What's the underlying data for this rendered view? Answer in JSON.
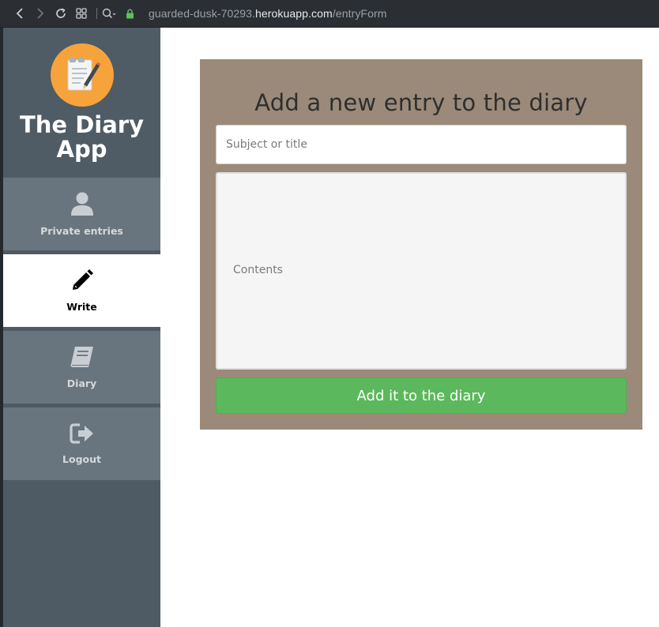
{
  "browser": {
    "url_host": "guarded-dusk-70293.",
    "url_domain": "herokuapp.com",
    "url_path": "/entryForm",
    "icons": [
      "back-icon",
      "forward-icon",
      "reload-icon",
      "tabs-grid-icon",
      "zoom-icon",
      "lock-icon"
    ]
  },
  "sidebar": {
    "app_title": "The Diary App",
    "logo_icon": "notepad-pen-icon",
    "items": [
      {
        "label": "Private entries",
        "icon": "user-icon",
        "active": false
      },
      {
        "label": "Write",
        "icon": "pencil-icon",
        "active": true
      },
      {
        "label": "Diary",
        "icon": "book-icon",
        "active": false
      },
      {
        "label": "Logout",
        "icon": "sign-out-icon",
        "active": false
      }
    ]
  },
  "form": {
    "title": "Add a new entry to the diary",
    "subject_placeholder": "Subject or title",
    "subject_value": "",
    "contents_placeholder": "Contents",
    "contents_value": "",
    "submit_label": "Add it to the diary"
  },
  "colors": {
    "sidebar_bg": "#4e5b64",
    "nav_item_bg": "#69757e",
    "card_bg": "#9b8a7a",
    "submit_bg": "#5cb85c",
    "logo_bg": "#f6a33c"
  }
}
